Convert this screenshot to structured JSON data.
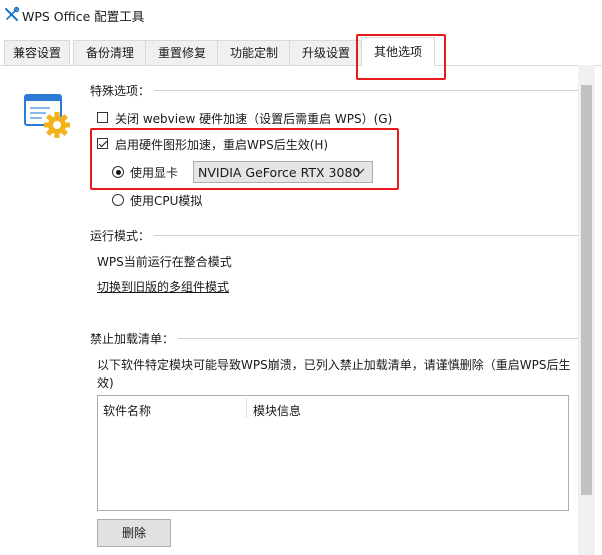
{
  "window": {
    "title": "WPS Office 配置工具"
  },
  "tabs": [
    {
      "label": "兼容设置",
      "active": false
    },
    {
      "label": "备份清理",
      "active": false
    },
    {
      "label": "重置修复",
      "active": false
    },
    {
      "label": "功能定制",
      "active": false
    },
    {
      "label": "升级设置",
      "active": false
    },
    {
      "label": "其他选项",
      "active": true
    }
  ],
  "special": {
    "title": "特殊选项：",
    "webview_label": "关闭 webview 硬件加速（设置后需重启 WPS）(G)",
    "webview_checked": false,
    "hw_label": "启用硬件图形加速，重启WPS后生效(H)",
    "hw_checked": true,
    "gpu_label": "使用显卡",
    "gpu_selected": true,
    "gpu_value": "NVIDIA GeForce RTX 3080",
    "cpu_label": "使用CPU模拟",
    "cpu_selected": false
  },
  "run_mode": {
    "title": "运行模式：",
    "status": "WPS当前运行在整合模式",
    "switch_link": "切换到旧版的多组件模式"
  },
  "blocklist": {
    "title": "禁止加载清单：",
    "desc_line1": "以下软件特定模块可能导致WPS崩溃，已列入禁止加载清单，请谨慎删除（重启WPS后生",
    "desc_line2": "效)",
    "col_software": "软件名称",
    "col_module": "模块信息",
    "delete_button": "删除"
  },
  "colors": {
    "highlight": "#e8191a"
  },
  "icons": {
    "app": "wrench-cross-icon",
    "settings": "settings-window-gear-icon"
  }
}
